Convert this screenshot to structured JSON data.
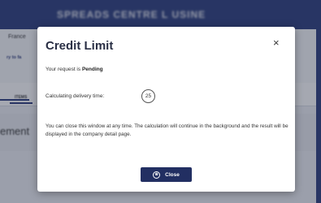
{
  "background": {
    "header_title": "SPREADS CENTRE L USINE",
    "country": "France",
    "link_text": "ry to fa",
    "tab_label": "ITEMS",
    "section_title": "ement"
  },
  "modal": {
    "title": "Credit Limit",
    "close_icon": "×",
    "status_prefix": "Your request is ",
    "status_value": "Pending",
    "calc_label": "Calculating delivery time:",
    "counter_value": "25",
    "info_text": "You can close this window at any time. The calculation will continue in the background and the result will be displayed in the company detail page.",
    "close_button_label": "Close",
    "close_button_icon": "⊗"
  },
  "colors": {
    "brand_dark": "#283a7a",
    "button": "#222f62"
  }
}
